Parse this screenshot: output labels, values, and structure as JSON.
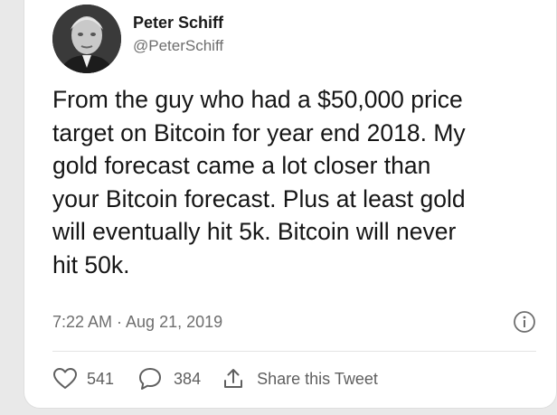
{
  "author": {
    "name": "Peter Schiff",
    "handle": "@PeterSchiff",
    "avatar_icon": "profile-photo"
  },
  "tweet": {
    "text": "From the guy who had a $50,000  price\ntarget on Bitcoin for year end 2018.  My\ngold forecast came a lot closer than\nyour Bitcoin forecast.  Plus at least gold\nwill eventually hit 5k.  Bitcoin will never\nhit 50k.",
    "timestamp": "7:22 AM · Aug 21, 2019",
    "info_icon": "info-circle"
  },
  "actions": {
    "likes": "541",
    "replies": "384",
    "share_label": "Share this Tweet",
    "like_icon": "heart-outline",
    "reply_icon": "speech-bubble",
    "share_icon": "share-upload"
  },
  "colors": {
    "background": "#e9e9e9",
    "card": "#ffffff",
    "text": "#161616",
    "secondary_text": "#6e6e6e"
  }
}
